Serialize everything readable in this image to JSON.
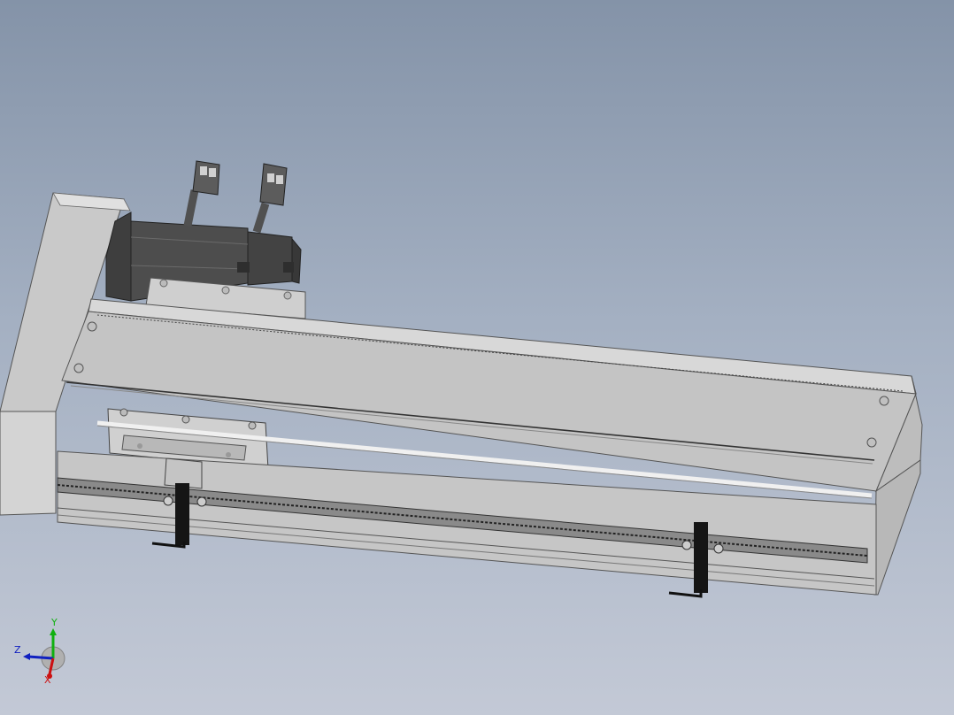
{
  "scene": {
    "background_top": "#8493a8",
    "background_bottom": "#c3c9d6",
    "model_color": "#c8c8c8",
    "motor_color": "#4a4a4a",
    "switch_color": "#111111"
  },
  "triad": {
    "x_label": "X",
    "y_label": "Y",
    "z_label": "Z",
    "x_color": "#cc1010",
    "y_color": "#10b010",
    "z_color": "#1020c0"
  }
}
